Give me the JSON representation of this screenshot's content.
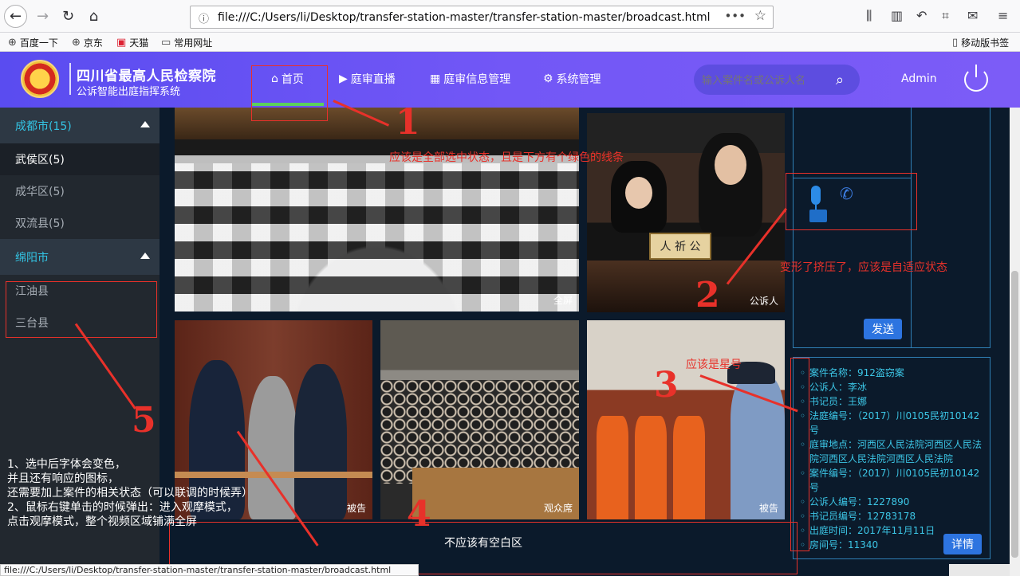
{
  "browser": {
    "url": "file:///C:/Users/li/Desktop/transfer-station-master/transfer-station-master/broadcast.html",
    "bookmarks": [
      {
        "label": "百度一下",
        "icon": "globe-icon"
      },
      {
        "label": "京东",
        "icon": "globe-icon"
      },
      {
        "label": "天猫",
        "icon": "tmall-icon"
      },
      {
        "label": "常用网址",
        "icon": "folder-icon"
      }
    ],
    "mobile_bookmarks": "移动版书签",
    "status_url": "file:///C:/Users/li/Desktop/transfer-station-master/transfer-station-master/broadcast.html"
  },
  "header": {
    "title": "四川省最高人民检察院",
    "subtitle": "公诉智能出庭指挥系统",
    "nav": [
      {
        "label": "首页",
        "icon": "home-icon",
        "active": true
      },
      {
        "label": "庭审直播",
        "icon": "play-circle-icon"
      },
      {
        "label": "庭审信息管理",
        "icon": "calendar-icon"
      },
      {
        "label": "系统管理",
        "icon": "gear-icon"
      }
    ],
    "search_placeholder": "输入案件名或公诉人名",
    "user": "Admin",
    "accent": "#5cd05c"
  },
  "sidebar": {
    "groups": [
      {
        "label": "成都市(15)",
        "items": [
          "武侯区(5)",
          "成华区(5)",
          "双流县(5)"
        ]
      },
      {
        "label": "绵阳市",
        "items": [
          "江油县",
          "三台县"
        ]
      }
    ]
  },
  "videos": [
    {
      "label": "全屏"
    },
    {
      "label": "公诉人",
      "plate": "人 祈 公"
    },
    {
      "label": "被告"
    },
    {
      "label": "观众席"
    },
    {
      "label": "被告"
    }
  ],
  "controls": {
    "send": "发送"
  },
  "case_info": {
    "items": [
      "案件名称：912盗窃案",
      "公诉人：李冰",
      "书记员：王娜",
      "法庭编号：（2017）川0105民初10142号",
      "庭审地点：河西区人民法院河西区人民法院河西区人民法院河西区人民法院",
      "案件编号：（2017）川0105民初10142号",
      "公诉人编号：1227890",
      "书记员编号：12783178",
      "出庭时间：2017年11月11日",
      "房间号：11340"
    ],
    "detail": "详情"
  },
  "annotations": {
    "n1": "1",
    "t1": "应该是全部选中状态，且是下方有个绿色的线条",
    "n2": "2",
    "t2": "变形了挤压了，应该是自适应状态",
    "n3": "3",
    "t3": "应该是星号",
    "n4": "4",
    "t4": "不应该有空白区",
    "n5": "5",
    "notes": [
      "1、选中后字体会变色，",
      "并且还有响应的图标，",
      "还需要加上案件的相关状态（可以联调的时候弄）",
      "2、鼠标右键单击的时候弹出：进入观摩模式，",
      "点击观摩模式，整个视频区域铺满全屏"
    ]
  }
}
